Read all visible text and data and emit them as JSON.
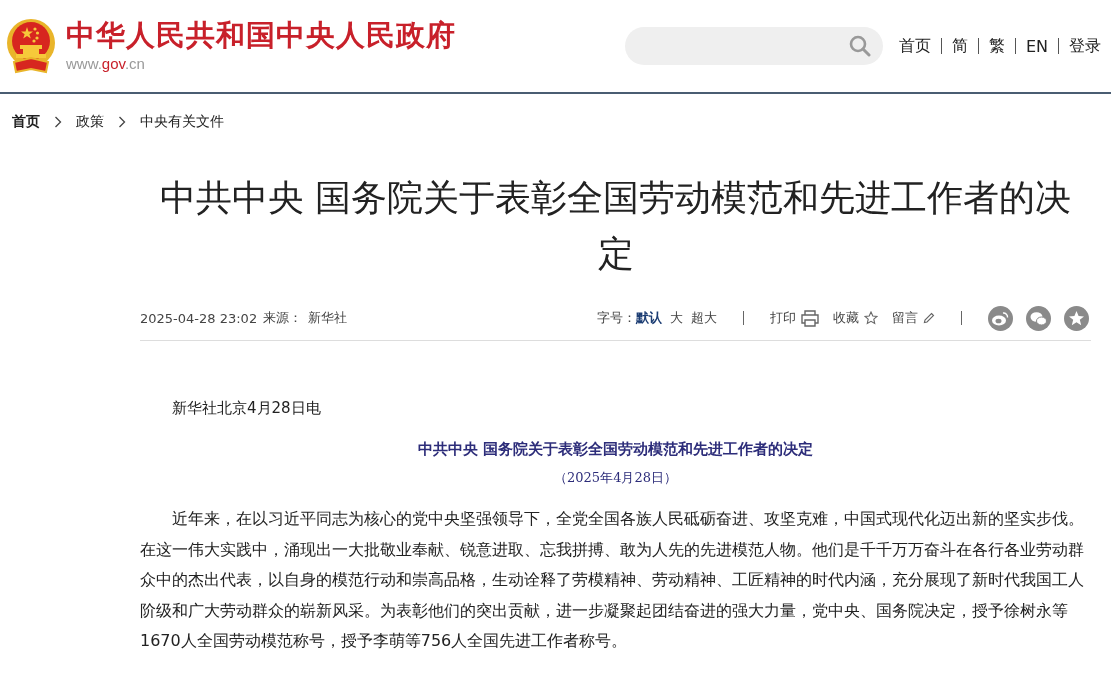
{
  "header": {
    "site_title": "中华人民共和国中央人民政府",
    "site_url": {
      "prefix": "www.",
      "domain": "gov",
      "suffix": ".cn"
    },
    "nav": [
      "首页",
      "简",
      "繁",
      "EN",
      "登录"
    ]
  },
  "breadcrumb": [
    "首页",
    "政策",
    "中央有关文件"
  ],
  "article": {
    "title": "中共中央 国务院关于表彰全国劳动模范和先进工作者的决定",
    "meta": {
      "datetime": "2025-04-28 23:02",
      "source_label": "来源：",
      "source": "新华社",
      "font_size_label": "字号：",
      "font_sizes": [
        {
          "label": "默认",
          "selected": true
        },
        {
          "label": "大",
          "selected": false
        },
        {
          "label": "超大",
          "selected": false
        }
      ],
      "actions": [
        {
          "kind": "print",
          "label": "打印"
        },
        {
          "kind": "favorite",
          "label": "收藏"
        },
        {
          "kind": "comment",
          "label": "留言"
        }
      ],
      "share": [
        {
          "kind": "weibo"
        },
        {
          "kind": "wechat"
        },
        {
          "kind": "favorite"
        }
      ]
    },
    "dateline": "新华社北京4月28日电",
    "doc_title": "中共中央 国务院关于表彰全国劳动模范和先进工作者的决定",
    "doc_date": "（2025年4月28日）",
    "paragraphs": [
      "近年来，在以习近平同志为核心的党中央坚强领导下，全党全国各族人民砥砺奋进、攻坚克难，中国式现代化迈出新的坚实步伐。在这一伟大实践中，涌现出一大批敬业奉献、锐意进取、忘我拼搏、敢为人先的先进模范人物。他们是千千万万奋斗在各行各业劳动群众中的杰出代表，以自身的模范行动和崇高品格，生动诠释了劳模精神、劳动精神、工匠精神的时代内涵，充分展现了新时代我国工人阶级和广大劳动群众的崭新风采。为表彰他们的突出贡献，进一步凝聚起团结奋进的强大力量，党中央、国务院决定，授予徐树永等1670人全国劳动模范称号，授予李萌等756人全国先进工作者称号。"
    ]
  }
}
